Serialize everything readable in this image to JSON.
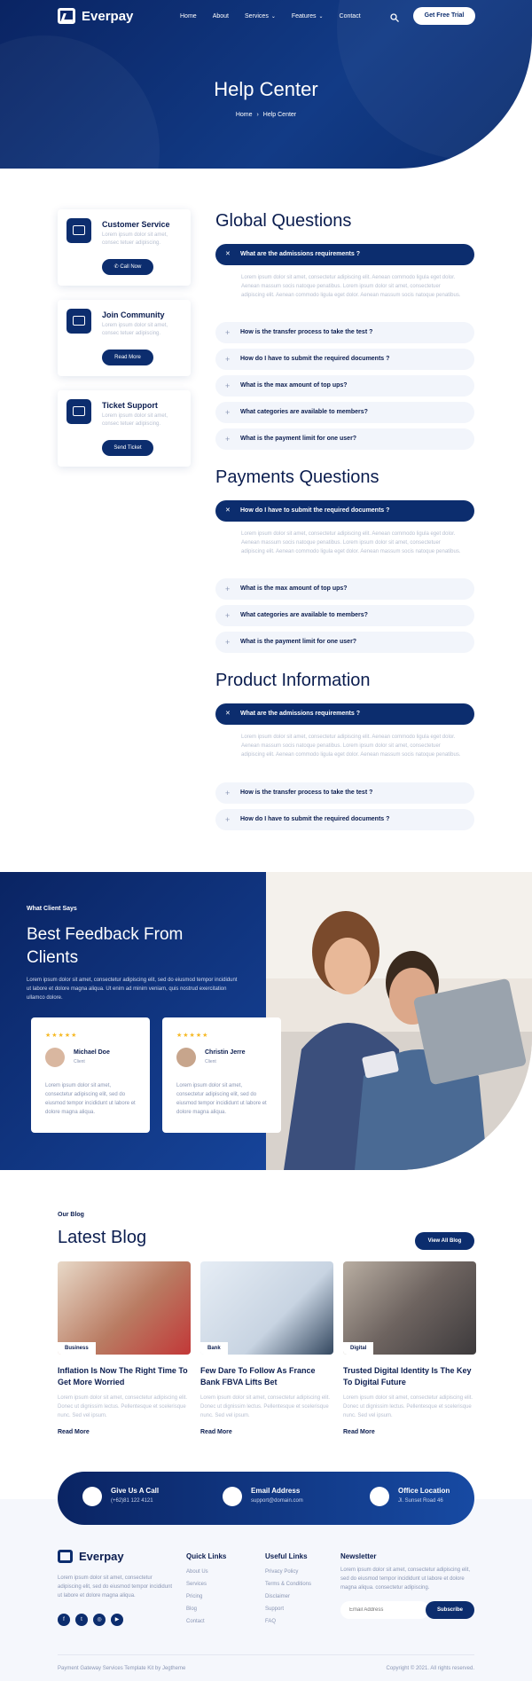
{
  "nav": {
    "brand": "Everpay",
    "links": [
      "Home",
      "About",
      "Services",
      "Features",
      "Contact"
    ],
    "cta": "Get Free Trial"
  },
  "hero": {
    "title": "Help Center",
    "crumb_home": "Home",
    "crumb_current": "Help Center"
  },
  "support_cards": [
    {
      "title": "Customer Service",
      "desc": "Lorem ipsum dolor sit amet, consec tetuer adipiscing.",
      "button": "Call Now"
    },
    {
      "title": "Join Community",
      "desc": "Lorem ipsum dolor sit amet, consec tetuer adipiscing.",
      "button": "Read More"
    },
    {
      "title": "Ticket Support",
      "desc": "Lorem ipsum dolor sit amet, consec tetuer adipiscing.",
      "button": "Send Ticket"
    }
  ],
  "faq": {
    "global": {
      "title": "Global Questions",
      "questions": [
        "What are the admissions requirements ?",
        "How is the transfer process to take the test ?",
        "How do I have to submit the required documents ?",
        "What is the max amount of top ups?",
        "What categories are available to members?",
        "What is the payment limit for one user?"
      ],
      "answer": "Lorem ipsum dolor sit amet, consectetur adipiscing elit. Aenean commodo ligula eget dolor. Aenean massum socis natoque penatibus. Lorem ipsum dolor sit amet, consectetuer adipiscing elit. Aenean commodo ligula eget dolor. Aenean massum socis natoque penatibus."
    },
    "payments": {
      "title": "Payments Questions",
      "questions": [
        "How do I have to submit the required documents ?",
        "What is the max amount of top ups?",
        "What categories are available to members?",
        "What is the payment limit for one user?"
      ],
      "answer": "Lorem ipsum dolor sit amet, consectetur adipiscing elit. Aenean commodo ligula eget dolor. Aenean massum socis natoque penatibus. Lorem ipsum dolor sit amet, consectetuer adipiscing elit. Aenean commodo ligula eget dolor. Aenean massum socis natoque penatibus."
    },
    "product": {
      "title": "Product Information",
      "questions": [
        "What are the admissions requirements ?",
        "How is the transfer process to take the test ?",
        "How do I have to submit the required documents ?"
      ],
      "answer": "Lorem ipsum dolor sit amet, consectetur adipiscing elit. Aenean commodo ligula eget dolor. Aenean massum socis natoque penatibus. Lorem ipsum dolor sit amet, consectetuer adipiscing elit. Aenean commodo ligula eget dolor. Aenean massum socis natoque penatibus."
    }
  },
  "testimonials": {
    "eyebrow": "What Client Says",
    "title_line1": "Best Feedback From",
    "title_line2": "Clients",
    "desc": "Lorem ipsum dolor sit amet, consectetur adipiscing elit, sed do eiusmod tempor incididunt ut labore et dolore magna aliqua. Ut enim ad minim veniam, quis nostrud exercitation ullamco dolore.",
    "items": [
      {
        "name": "Michael Doe",
        "role": "Client",
        "rating": 4.5,
        "stars": "★★★★★",
        "text": "Lorem ipsum dolor sit amet, consectetur adipiscing elit, sed do eiusmod tempor incididunt ut labore et dolore magna aliqua."
      },
      {
        "name": "Christin Jerre",
        "role": "Client",
        "rating": 4.5,
        "stars": "★★★★★",
        "text": "Lorem ipsum dolor sit amet, consectetur adipiscing elit, sed do eiusmod tempor incididunt ut labore et dolore magna aliqua."
      }
    ]
  },
  "blog": {
    "eyebrow": "Our Blog",
    "title": "Latest Blog",
    "button": "View All Blog",
    "posts": [
      {
        "tag": "Business",
        "title": "Inflation Is Now The Right Time To Get More Worried",
        "desc": "Lorem ipsum dolor sit amet, consectetur adipiscing elit. Donec ut dignissim lectus. Pellentesque et scelerisque nunc. Sed vel ipsum.",
        "link": "Read More"
      },
      {
        "tag": "Bank",
        "title": "Few Dare To Follow As France Bank FBVA Lifts Bet",
        "desc": "Lorem ipsum dolor sit amet, consectetur adipiscing elit. Donec ut dignissim lectus. Pellentesque et scelerisque nunc. Sed vel ipsum.",
        "link": "Read More"
      },
      {
        "tag": "Digital",
        "title": "Trusted Digital Identity Is The Key To Digital Future",
        "desc": "Lorem ipsum dolor sit amet, consectetur adipiscing elit. Donec ut dignissim lectus. Pellentesque et scelerisque nunc. Sed vel ipsum.",
        "link": "Read More"
      }
    ]
  },
  "contact": [
    {
      "title": "Give Us A Call",
      "sub": "(+62)81 122 4121"
    },
    {
      "title": "Email Address",
      "sub": "support@domain.com"
    },
    {
      "title": "Office Location",
      "sub": "Jl. Sunset Road 46"
    }
  ],
  "footer": {
    "brand": "Everpay",
    "about": "Lorem ipsum dolor sit amet, consectetur adipiscing elit, sed do eiusmod tempor incididunt ut labore et dolore magna aliqua.",
    "quick_title": "Quick Links",
    "quick": [
      "About Us",
      "Services",
      "Pricing",
      "Blog",
      "Contact"
    ],
    "useful_title": "Useful Links",
    "useful": [
      "Privacy Policy",
      "Terms & Conditions",
      "Disclaimer",
      "Support",
      "FAQ"
    ],
    "news_title": "Newsletter",
    "news_desc": "Lorem ipsum dolor sit amet, consectetur adipiscing elit, sed do eiusmod tempor incididunt ut labore et dolore magna aliqua. consectetur adipiscing.",
    "email_placeholder": "Email Address",
    "subscribe": "Subscribe",
    "bottom_left": "Payment Gateway Services Template Kit by Jegtheme",
    "bottom_right": "Copyright © 2021. All rights reserved."
  }
}
